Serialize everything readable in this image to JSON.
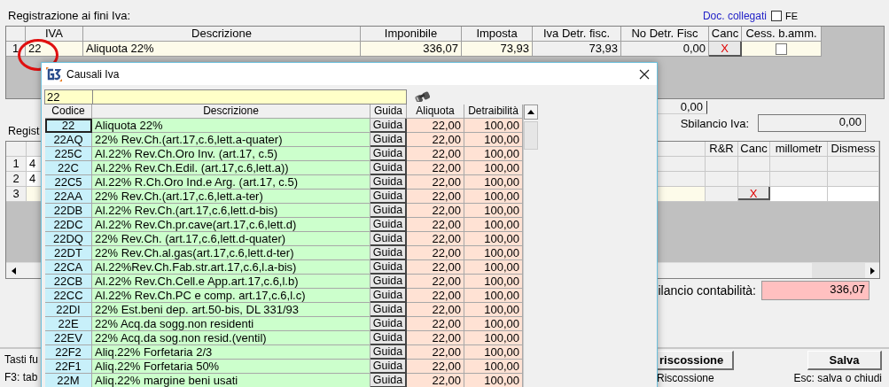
{
  "form": {
    "title": "Registrazione ai fini Iva:",
    "doc_link": "Doc. collegati",
    "fe_checkbox": {
      "label": "FE",
      "checked": false
    }
  },
  "vat_grid": {
    "columns": [
      "IVA",
      "Descrizione",
      "Imponibile",
      "Imposta",
      "Iva Detr. fisc.",
      "No Detr. Fisc",
      "Canc",
      "Cess. b.amm."
    ],
    "rows": [
      {
        "number": "1",
        "iva": "22",
        "descrizione": "Aliquota 22%",
        "imponibile": "336,07",
        "imposta": "73,93",
        "iva_detr_fisc": "73,93",
        "no_detr_fisc": "0,00",
        "canc": "X",
        "cess_b_amm": false
      }
    ]
  },
  "total_field": "0,00",
  "sbilancio_iva": {
    "label": "Sbilancio Iva:",
    "value": "0,00"
  },
  "section_2_title": "Regist",
  "accounts_grid": {
    "columns": [
      "R&R",
      "Canc",
      "millometr",
      "Dismess"
    ],
    "rows": [
      {
        "number": "1",
        "column_2": "4",
        "kind": "saved"
      },
      {
        "number": "2",
        "column_2": "4",
        "kind": "saved"
      },
      {
        "number": "3",
        "kind": "new",
        "canc": "X"
      }
    ]
  },
  "sbilancio_contabilita": {
    "label": "ilancio contabilità:",
    "value": "336,07"
  },
  "footer": {
    "hint_1": "Tasti fu",
    "hint_2": "F3: tab",
    "riscossione_button": "riscossione",
    "riscossione_hint": "Riscossione",
    "save_button": "Salva",
    "save_hint": "Esc: salva o chiudi"
  },
  "dialog": {
    "title": "Causali Iva",
    "search": {
      "code_value": "22"
    },
    "columns": [
      "Codice",
      "Descrizione",
      "Guida",
      "Aliquota",
      "Detraibilità"
    ],
    "rows": [
      {
        "codice": "22",
        "descrizione": "Aliquota 22%",
        "guida": "Guida",
        "aliquota": "22,00",
        "detraibilita": "100,00",
        "selected": true
      },
      {
        "codice": "22AQ",
        "descrizione": "22% Rev.Ch.(art.17,c.6,lett.a-quater)",
        "guida": "Guida",
        "aliquota": "22,00",
        "detraibilita": "100,00",
        "selected": false
      },
      {
        "codice": "225C",
        "descrizione": "Al.22% Rev.Ch.Oro Inv. (art.17, c.5)",
        "guida": "Guida",
        "aliquota": "22,00",
        "detraibilita": "100,00",
        "selected": false
      },
      {
        "codice": "22C",
        "descrizione": "Al.22% Rev.Ch.Edil. (art.17,c.6,lett.a))",
        "guida": "Guida",
        "aliquota": "22,00",
        "detraibilita": "100,00",
        "selected": false
      },
      {
        "codice": "22C5",
        "descrizione": "Al.22% R.Ch.Oro Ind.e Arg. (art.17, c.5)",
        "guida": "Guida",
        "aliquota": "22,00",
        "detraibilita": "100,00",
        "selected": false
      },
      {
        "codice": "22AA",
        "descrizione": "22% Rev.Ch.(art.17,c.6,lett.a-ter)",
        "guida": "Guida",
        "aliquota": "22,00",
        "detraibilita": "100,00",
        "selected": false
      },
      {
        "codice": "22DB",
        "descrizione": "Al.22% Rev.Ch.(art.17,c.6,lett.d-bis)",
        "guida": "Guida",
        "aliquota": "22,00",
        "detraibilita": "100,00",
        "selected": false
      },
      {
        "codice": "22DC",
        "descrizione": "Al.22% Rev.Ch.pr.cave(art.17,c.6,lett.d)",
        "guida": "Guida",
        "aliquota": "22,00",
        "detraibilita": "100,00",
        "selected": false
      },
      {
        "codice": "22DQ",
        "descrizione": "22% Rev.Ch. (art.17,c.6,lett.d-quater)",
        "guida": "Guida",
        "aliquota": "22,00",
        "detraibilita": "100,00",
        "selected": false
      },
      {
        "codice": "22DT",
        "descrizione": "22% Rev.Ch.al.gas(art.17,c.6,lett.d-ter)",
        "guida": "Guida",
        "aliquota": "22,00",
        "detraibilita": "100,00",
        "selected": false
      },
      {
        "codice": "22CA",
        "descrizione": "Al.22%Rev.Ch.Fab.str.art.17,c.6,l.a-bis)",
        "guida": "Guida",
        "aliquota": "22,00",
        "detraibilita": "100,00",
        "selected": false
      },
      {
        "codice": "22CB",
        "descrizione": "Al.22% Rev.Ch.Cell.e App.art.17,c.6,l.b)",
        "guida": "Guida",
        "aliquota": "22,00",
        "detraibilita": "100,00",
        "selected": false
      },
      {
        "codice": "22CC",
        "descrizione": "Al.22% Rev.Ch.PC e comp. art.17,c.6,l.c)",
        "guida": "Guida",
        "aliquota": "22,00",
        "detraibilita": "100,00",
        "selected": false
      },
      {
        "codice": "22DI",
        "descrizione": "22% Est.beni dep. art.50-bis, DL 331/93",
        "guida": "Guida",
        "aliquota": "22,00",
        "detraibilita": "100,00",
        "selected": false
      },
      {
        "codice": "22E",
        "descrizione": "22% Acq.da sogg.non residenti",
        "guida": "Guida",
        "aliquota": "22,00",
        "detraibilita": "100,00",
        "selected": false
      },
      {
        "codice": "22EV",
        "descrizione": "22% Acq.da sog.non resid.(ventil)",
        "guida": "Guida",
        "aliquota": "22,00",
        "detraibilita": "100,00",
        "selected": false
      },
      {
        "codice": "22F2",
        "descrizione": "Aliq.22% Forfetaria 2/3",
        "guida": "Guida",
        "aliquota": "22,00",
        "detraibilita": "100,00",
        "selected": false
      },
      {
        "codice": "22F1",
        "descrizione": "Aliq.22% Forfetaria 50%",
        "guida": "Guida",
        "aliquota": "22,00",
        "detraibilita": "100,00",
        "selected": false
      },
      {
        "codice": "22M",
        "descrizione": "Aliq.22% margine beni usati",
        "guida": "Guida",
        "aliquota": "22,00",
        "detraibilita": "100,00",
        "selected": false
      }
    ]
  }
}
